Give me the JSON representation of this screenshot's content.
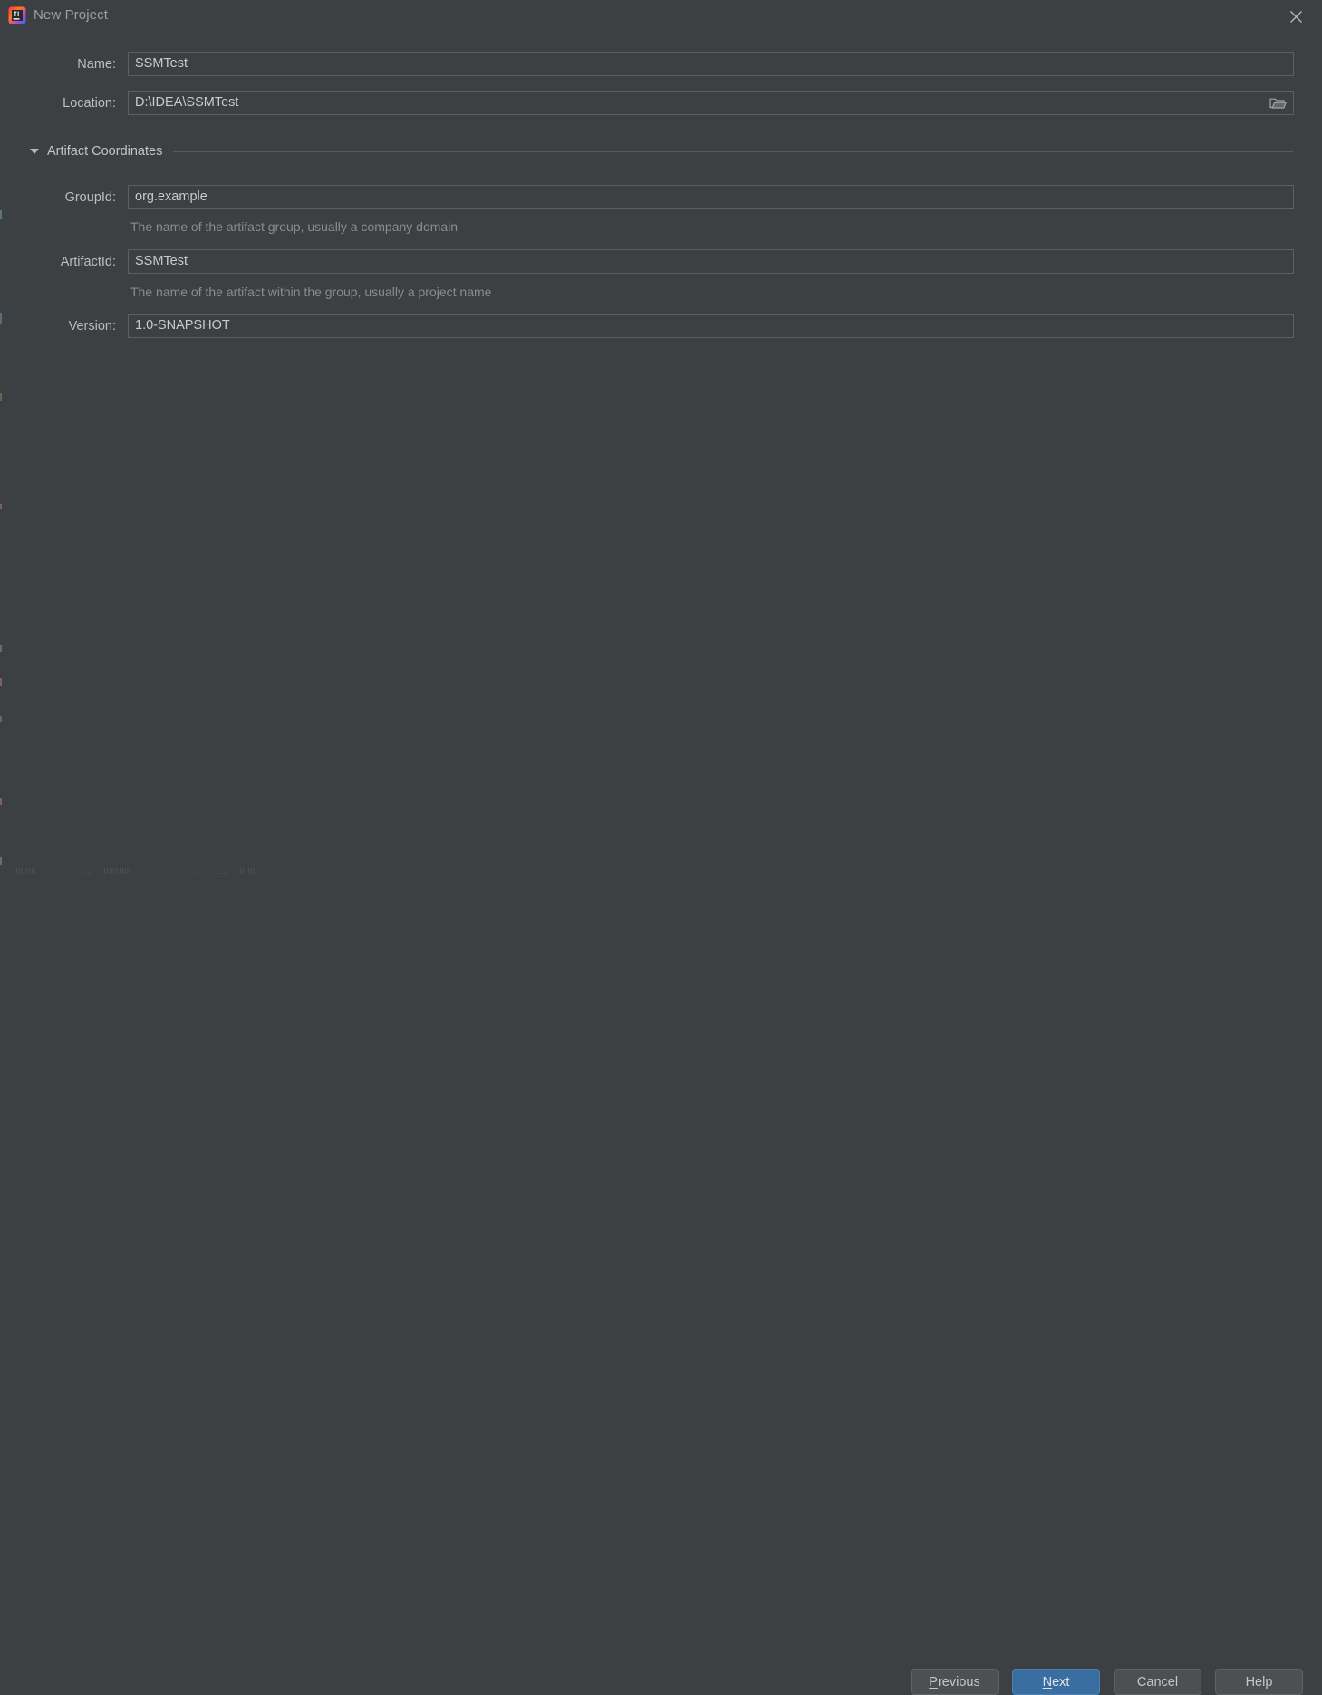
{
  "window": {
    "title": "New Project",
    "app_icon": "intellij-idea-icon",
    "close_icon": "close-icon",
    "background_color": "#3c4043"
  },
  "form": {
    "name": {
      "label": "Name:",
      "value": "SSMTest",
      "placeholder": ""
    },
    "location": {
      "label": "Location:",
      "value": "D:\\IDEA\\SSMTest",
      "placeholder": "",
      "browse_icon": "folder-icon"
    }
  },
  "artifact_section": {
    "title": "Artifact Coordinates",
    "expanded": true,
    "toggle_icon": "chevron-down-icon",
    "group_id": {
      "label": "GroupId:",
      "value": "org.example",
      "hint": "The name of the artifact group, usually a company domain"
    },
    "artifact_id": {
      "label": "ArtifactId:",
      "value": "SSMTest",
      "hint": "The name of the artifact within the group, usually a project name"
    },
    "version": {
      "label": "Version:",
      "value": "1.0-SNAPSHOT",
      "hint": ""
    }
  },
  "footer": {
    "previous": {
      "label": "Previous",
      "mnemonic": "P",
      "rest": "revious"
    },
    "next": {
      "label": "Next",
      "mnemonic": "N",
      "rest": "ext",
      "primary": true,
      "accent_color": "#3b6ea0"
    },
    "cancel": {
      "label": "Cancel"
    },
    "help": {
      "label": "Help"
    }
  }
}
